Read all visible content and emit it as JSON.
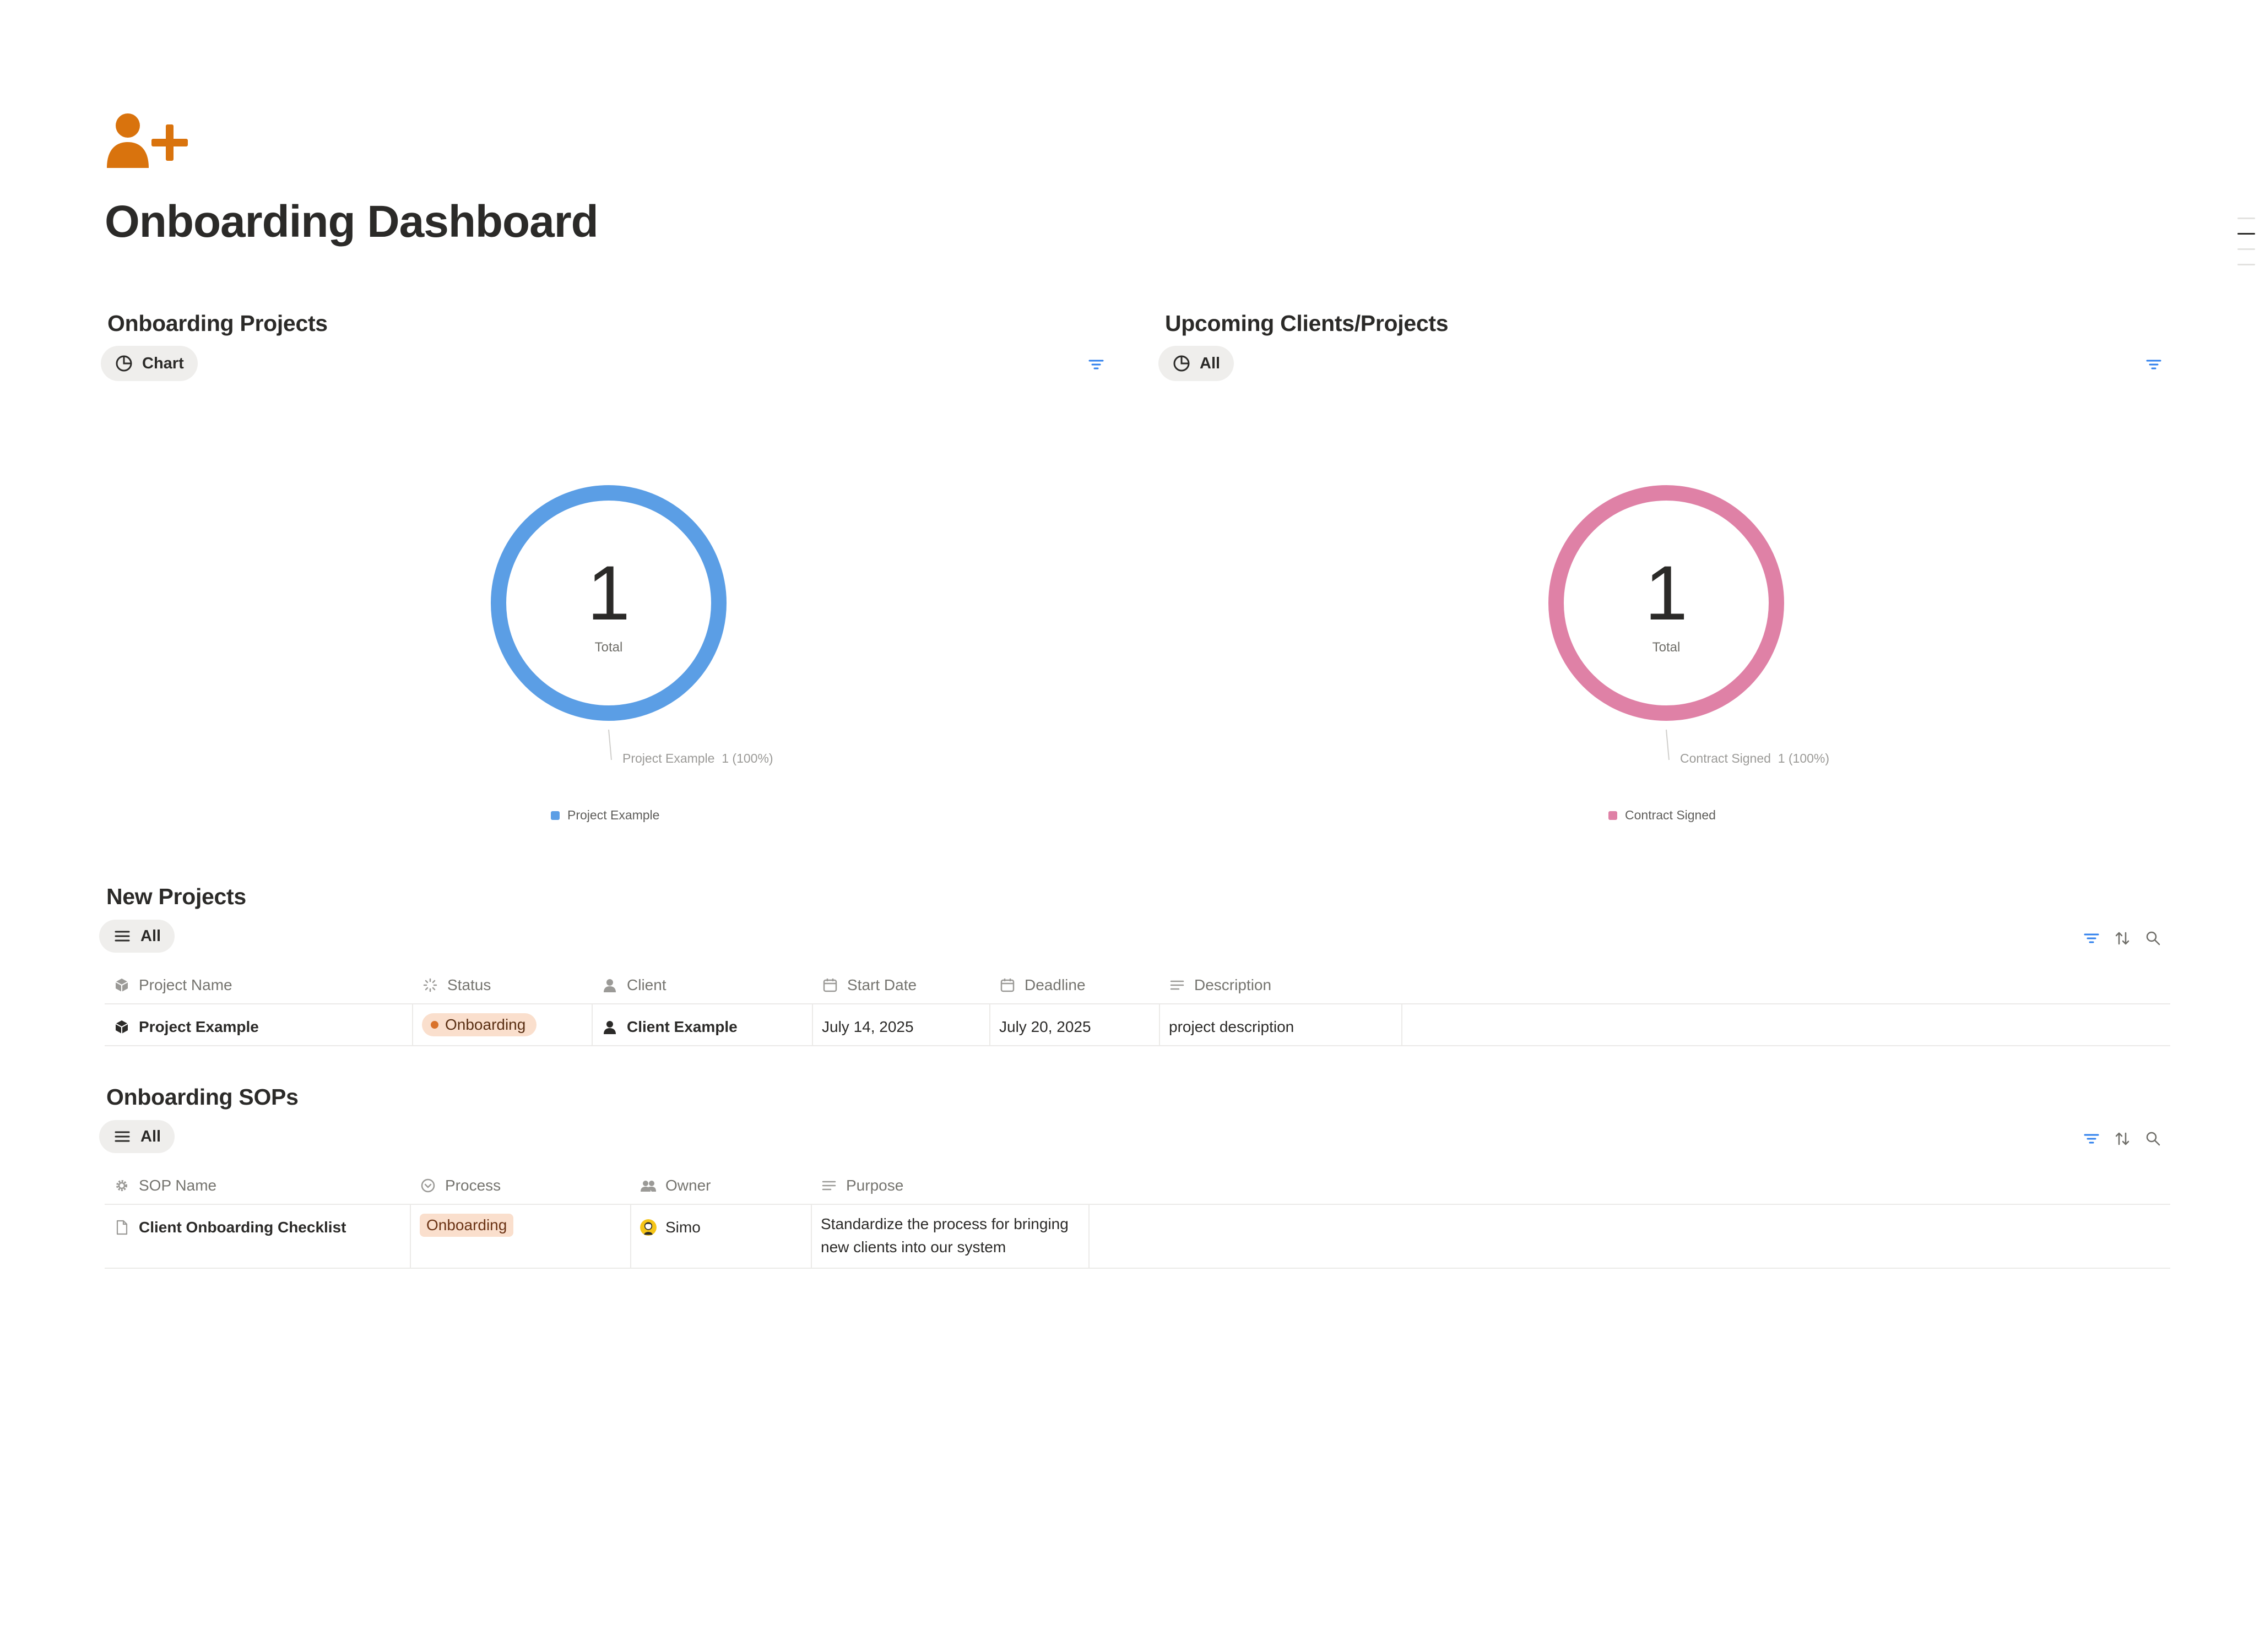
{
  "page": {
    "title": "Onboarding Dashboard",
    "icon": "person-add-icon",
    "icon_color": "#d9730d"
  },
  "charts_section": [
    {
      "title": "Onboarding Projects",
      "view_label": "Chart",
      "view_icon": "pie-chart-icon",
      "total_value": "1",
      "total_label": "Total",
      "callout": "Project Example  1 (100%)",
      "legend": "Project Example",
      "color": "#5b9ee5"
    },
    {
      "title": "Upcoming Clients/Projects",
      "view_label": "All",
      "view_icon": "pie-chart-icon",
      "total_value": "1",
      "total_label": "Total",
      "callout": "Contract Signed  1 (100%)",
      "legend": "Contract Signed",
      "color": "#df81a6"
    }
  ],
  "chart_data": [
    {
      "type": "pie",
      "title": "Onboarding Projects",
      "categories": [
        "Project Example"
      ],
      "values": [
        1
      ],
      "percent": [
        100
      ],
      "total": 1,
      "colors": [
        "#5b9ee5"
      ],
      "legend_position": "bottom"
    },
    {
      "type": "pie",
      "title": "Upcoming Clients/Projects",
      "categories": [
        "Contract Signed"
      ],
      "values": [
        1
      ],
      "percent": [
        100
      ],
      "total": 1,
      "colors": [
        "#df81a6"
      ],
      "legend_position": "bottom"
    }
  ],
  "new_projects": {
    "title": "New Projects",
    "view_label": "All",
    "columns": [
      "Project Name",
      "Status",
      "Client",
      "Start Date",
      "Deadline",
      "Description"
    ],
    "rows": [
      {
        "name": "Project Example",
        "status": "Onboarding",
        "client": "Client Example",
        "start_date": "July 14, 2025",
        "deadline": "July 20, 2025",
        "description": "project description"
      }
    ]
  },
  "sops": {
    "title": "Onboarding SOPs",
    "view_label": "All",
    "columns": [
      "SOP Name",
      "Process",
      "Owner",
      "Purpose"
    ],
    "rows": [
      {
        "name": "Client Onboarding Checklist",
        "process": "Onboarding",
        "owner": "Simo",
        "purpose": "Standardize the process for bringing new clients into our system"
      }
    ]
  },
  "colors": {
    "accent_blue": "#2f80ed",
    "status_orange": "#d9722b",
    "tag_bg": "#fadfcd"
  }
}
